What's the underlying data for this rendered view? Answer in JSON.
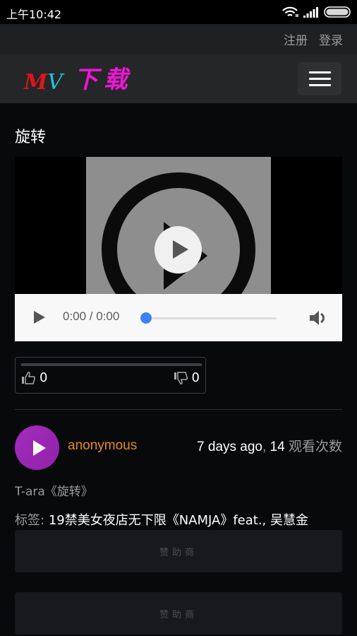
{
  "status_bar": {
    "time": "上午10:42",
    "icons": [
      "wifi-icon",
      "signal-icon",
      "battery-icon"
    ]
  },
  "top_nav": {
    "register": "注册",
    "login": "登录"
  },
  "navbar": {
    "logo_m": "M",
    "logo_v": "V",
    "logo_cn": "下载",
    "menu_icon": "hamburger-menu-icon"
  },
  "video": {
    "title": "旋转",
    "current_time": "0:00",
    "duration": "0:00",
    "time_display": "0:00 / 0:00",
    "progress_fraction": 0,
    "accent_color": "#3b82f6"
  },
  "votes": {
    "likes": "0",
    "dislikes": "0"
  },
  "details": {
    "author": "anonymous",
    "posted": "7 days ago",
    "separator": ",",
    "views": "14",
    "views_unit": "观看次数",
    "description": "T-ara《旋转》",
    "tags_label": "标签:",
    "tags": "19禁美女夜店无下限《NAMJA》feat., 吴慧金"
  },
  "sponsors": [
    {
      "label": "赞助商"
    },
    {
      "label": "赞助商"
    }
  ]
}
